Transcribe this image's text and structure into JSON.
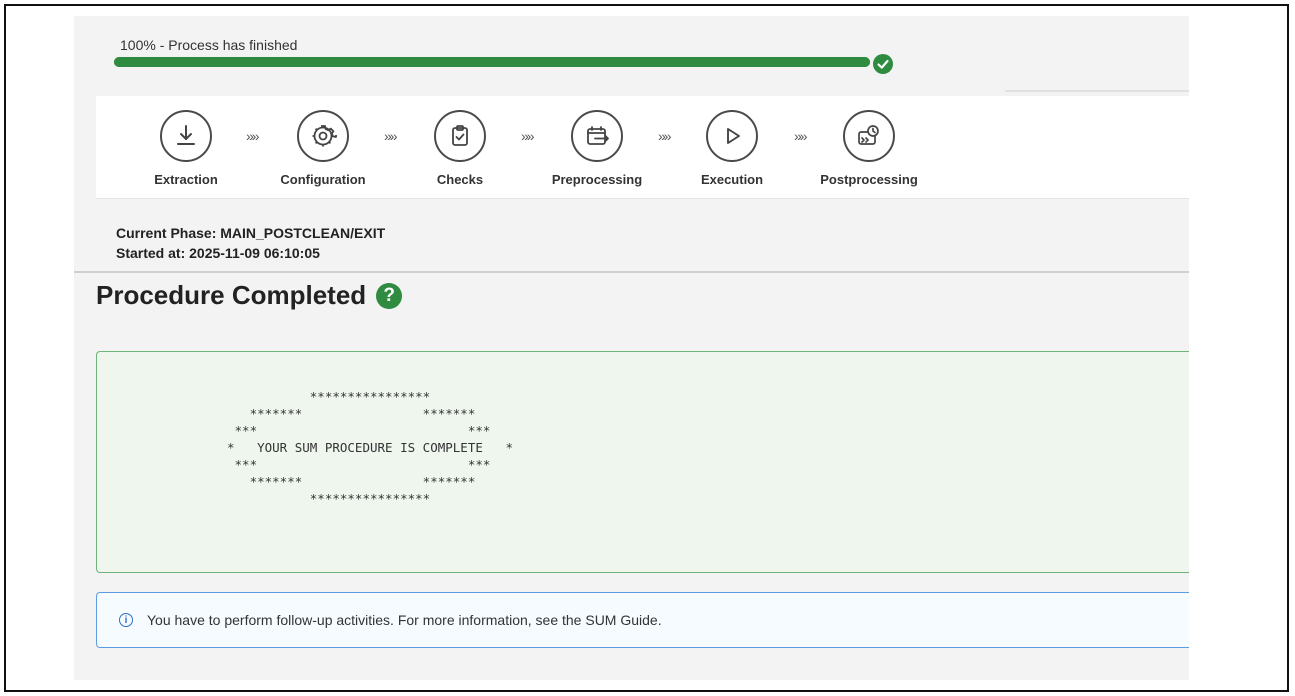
{
  "progress": {
    "label": "100% - Process has finished",
    "percent": 100
  },
  "steps": [
    {
      "label": "Extraction",
      "icon": "download-icon"
    },
    {
      "label": "Configuration",
      "icon": "gear-icon"
    },
    {
      "label": "Checks",
      "icon": "clipboard-check-icon"
    },
    {
      "label": "Preprocessing",
      "icon": "calendar-arrow-icon"
    },
    {
      "label": "Execution",
      "icon": "play-icon"
    },
    {
      "label": "Postprocessing",
      "icon": "clock-forward-icon"
    }
  ],
  "step_separator": "»»",
  "phase": {
    "current": "Current Phase: MAIN_POSTCLEAN/EXIT",
    "started": "Started at: 2025-11-09 06:10:05"
  },
  "title": "Procedure Completed",
  "help_icon_glyph": "?",
  "log_text": "           ****************\n   *******                *******\n ***                            ***\n*   YOUR SUM PROCEDURE IS COMPLETE   *\n ***                            ***\n   *******                *******\n           ****************",
  "info": {
    "icon_glyph": "i",
    "text": "You have to perform follow-up activities. For more information, see the SUM Guide."
  },
  "colors": {
    "success": "#2e8b3f",
    "info": "#2c6ecb"
  }
}
